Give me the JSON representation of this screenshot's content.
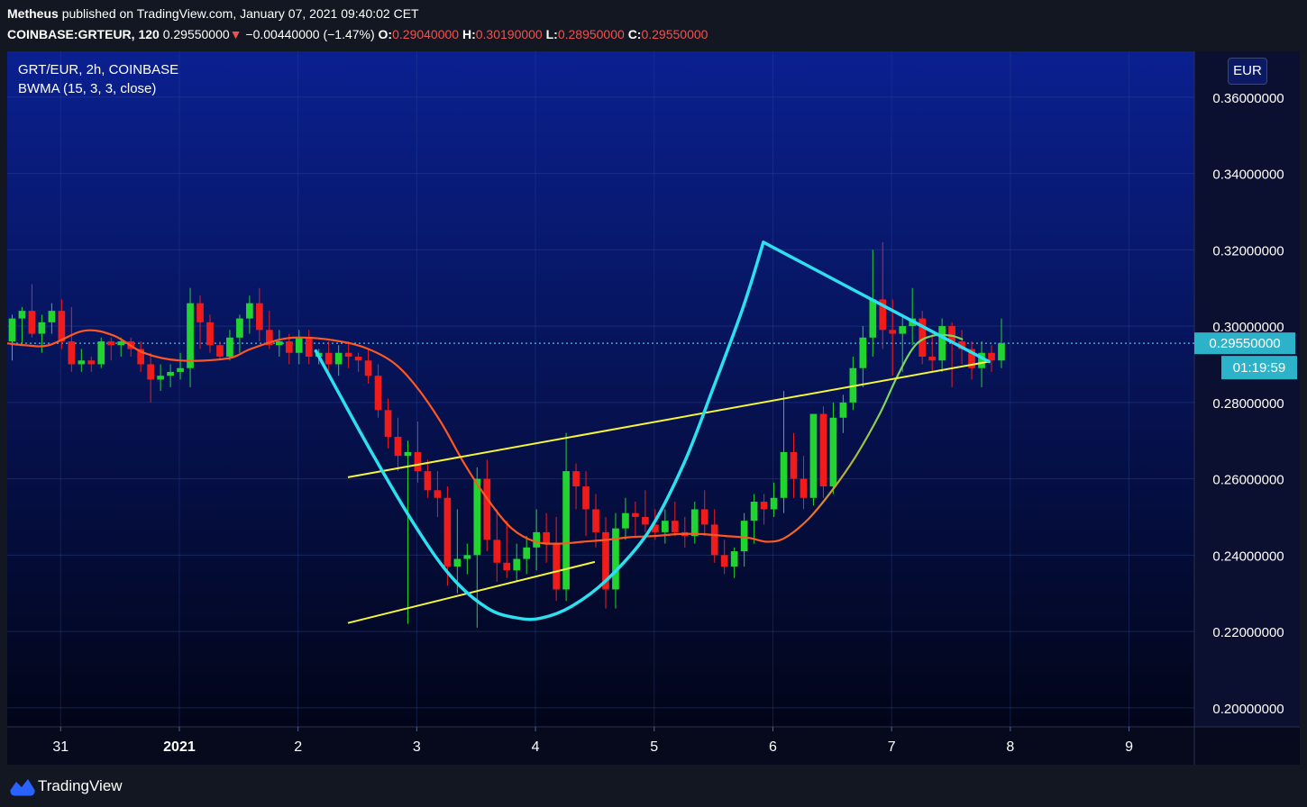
{
  "header": {
    "author": "Metheus",
    "published_text": "published on TradingView.com, January 07, 2021 09:40:02 CET",
    "symbol_text": "COINBASE:GRTEUR, 120",
    "last_price": "0.29550000",
    "change_arrow": "▼",
    "change_text": "−0.00440000 (−1.47%)",
    "open_label": "O:",
    "open_value": "0.29040000",
    "high_label": "H:",
    "high_value": "0.30190000",
    "low_label": "L:",
    "low_value": "0.28950000",
    "close_label": "C:",
    "close_value": "0.29550000"
  },
  "legend": {
    "symbol": "GRT/EUR, 2h, COINBASE",
    "indicator": "BWMA (15, 3, 3, close)"
  },
  "currency_button": "EUR",
  "price_label": "0.29550000",
  "countdown_label": "01:19:59",
  "footer": {
    "brand": "TradingView"
  },
  "colors": {
    "bullish": "#22d430",
    "bearish": "#f01c1c",
    "pattern_cyan": "#2ce0f0",
    "trendline_yellow": "#f5f53a",
    "bwma_orange": "#ff5722",
    "bwma_green": "#7cd85a",
    "background_top": "#0a2090",
    "background_bottom": "#020518"
  },
  "chart_data": {
    "type": "candlestick",
    "symbol": "GRT/EUR",
    "interval": "2h",
    "y_axis": {
      "range": [
        0.195,
        0.372
      ],
      "ticks": [
        "0.36000000",
        "0.34000000",
        "0.32000000",
        "0.30000000",
        "0.28000000",
        "0.26000000",
        "0.24000000",
        "0.22000000",
        "0.20000000"
      ],
      "tick_values": [
        0.36,
        0.34,
        0.32,
        0.3,
        0.28,
        0.26,
        0.24,
        0.22,
        0.2
      ],
      "position": "right"
    },
    "x_axis": {
      "labels": [
        "31",
        "2021",
        "2",
        "3",
        "4",
        "5",
        "6",
        "7",
        "8",
        "9"
      ],
      "label_days": [
        -1,
        0,
        1,
        2,
        3,
        4,
        5,
        6,
        7,
        8
      ],
      "range_days": [
        -1.45,
        8.55
      ]
    },
    "grid": true,
    "last_price_line": 0.2955,
    "candles_day_offset_start": -1.45,
    "candles_step_days": 0.0833333,
    "candles_ohlc": [
      [
        0.296,
        0.303,
        0.291,
        0.302
      ],
      [
        0.302,
        0.305,
        0.295,
        0.304
      ],
      [
        0.304,
        0.311,
        0.297,
        0.298
      ],
      [
        0.298,
        0.303,
        0.293,
        0.301
      ],
      [
        0.301,
        0.306,
        0.298,
        0.304
      ],
      [
        0.304,
        0.307,
        0.294,
        0.296
      ],
      [
        0.296,
        0.305,
        0.288,
        0.29
      ],
      [
        0.29,
        0.294,
        0.288,
        0.291
      ],
      [
        0.291,
        0.292,
        0.288,
        0.29
      ],
      [
        0.29,
        0.297,
        0.289,
        0.296
      ],
      [
        0.296,
        0.297,
        0.291,
        0.295
      ],
      [
        0.295,
        0.297,
        0.292,
        0.296
      ],
      [
        0.296,
        0.297,
        0.292,
        0.294
      ],
      [
        0.294,
        0.296,
        0.288,
        0.29
      ],
      [
        0.29,
        0.293,
        0.28,
        0.286
      ],
      [
        0.286,
        0.29,
        0.283,
        0.287
      ],
      [
        0.287,
        0.29,
        0.284,
        0.288
      ],
      [
        0.288,
        0.293,
        0.286,
        0.289
      ],
      [
        0.289,
        0.31,
        0.284,
        0.306
      ],
      [
        0.306,
        0.308,
        0.294,
        0.301
      ],
      [
        0.301,
        0.303,
        0.293,
        0.295
      ],
      [
        0.295,
        0.296,
        0.291,
        0.292
      ],
      [
        0.292,
        0.299,
        0.291,
        0.297
      ],
      [
        0.297,
        0.303,
        0.293,
        0.302
      ],
      [
        0.302,
        0.308,
        0.298,
        0.306
      ],
      [
        0.306,
        0.31,
        0.296,
        0.299
      ],
      [
        0.299,
        0.304,
        0.294,
        0.295
      ],
      [
        0.295,
        0.299,
        0.292,
        0.296
      ],
      [
        0.296,
        0.298,
        0.29,
        0.293
      ],
      [
        0.293,
        0.299,
        0.29,
        0.297
      ],
      [
        0.297,
        0.299,
        0.29,
        0.292
      ],
      [
        0.292,
        0.294,
        0.29,
        0.293
      ],
      [
        0.293,
        0.296,
        0.288,
        0.29
      ],
      [
        0.29,
        0.295,
        0.287,
        0.293
      ],
      [
        0.293,
        0.296,
        0.289,
        0.292
      ],
      [
        0.292,
        0.293,
        0.288,
        0.291
      ],
      [
        0.291,
        0.294,
        0.285,
        0.287
      ],
      [
        0.287,
        0.29,
        0.276,
        0.278
      ],
      [
        0.278,
        0.281,
        0.268,
        0.271
      ],
      [
        0.271,
        0.276,
        0.262,
        0.266
      ],
      [
        0.266,
        0.27,
        0.222,
        0.267
      ],
      [
        0.267,
        0.275,
        0.259,
        0.262
      ],
      [
        0.262,
        0.265,
        0.255,
        0.257
      ],
      [
        0.257,
        0.262,
        0.25,
        0.255
      ],
      [
        0.255,
        0.258,
        0.232,
        0.237
      ],
      [
        0.237,
        0.252,
        0.23,
        0.239
      ],
      [
        0.239,
        0.243,
        0.235,
        0.24
      ],
      [
        0.24,
        0.263,
        0.221,
        0.26
      ],
      [
        0.26,
        0.265,
        0.241,
        0.244
      ],
      [
        0.244,
        0.252,
        0.233,
        0.238
      ],
      [
        0.238,
        0.249,
        0.234,
        0.236
      ],
      [
        0.236,
        0.243,
        0.233,
        0.239
      ],
      [
        0.239,
        0.245,
        0.235,
        0.242
      ],
      [
        0.242,
        0.252,
        0.236,
        0.246
      ],
      [
        0.246,
        0.251,
        0.238,
        0.243
      ],
      [
        0.243,
        0.25,
        0.228,
        0.231
      ],
      [
        0.231,
        0.272,
        0.228,
        0.262
      ],
      [
        0.262,
        0.264,
        0.252,
        0.258
      ],
      [
        0.258,
        0.262,
        0.245,
        0.252
      ],
      [
        0.252,
        0.256,
        0.242,
        0.246
      ],
      [
        0.246,
        0.25,
        0.226,
        0.231
      ],
      [
        0.231,
        0.251,
        0.226,
        0.247
      ],
      [
        0.247,
        0.255,
        0.244,
        0.251
      ],
      [
        0.251,
        0.254,
        0.245,
        0.25
      ],
      [
        0.25,
        0.257,
        0.246,
        0.248
      ],
      [
        0.248,
        0.252,
        0.244,
        0.246
      ],
      [
        0.246,
        0.252,
        0.243,
        0.249
      ],
      [
        0.249,
        0.254,
        0.245,
        0.246
      ],
      [
        0.246,
        0.25,
        0.242,
        0.245
      ],
      [
        0.245,
        0.254,
        0.243,
        0.252
      ],
      [
        0.252,
        0.257,
        0.245,
        0.248
      ],
      [
        0.248,
        0.252,
        0.238,
        0.24
      ],
      [
        0.24,
        0.244,
        0.235,
        0.237
      ],
      [
        0.237,
        0.242,
        0.234,
        0.241
      ],
      [
        0.241,
        0.251,
        0.237,
        0.249
      ],
      [
        0.249,
        0.256,
        0.243,
        0.254
      ],
      [
        0.254,
        0.256,
        0.248,
        0.252
      ],
      [
        0.252,
        0.259,
        0.25,
        0.255
      ],
      [
        0.255,
        0.283,
        0.251,
        0.267
      ],
      [
        0.267,
        0.272,
        0.255,
        0.26
      ],
      [
        0.26,
        0.266,
        0.252,
        0.255
      ],
      [
        0.255,
        0.273,
        0.253,
        0.277
      ],
      [
        0.277,
        0.279,
        0.255,
        0.258
      ],
      [
        0.258,
        0.28,
        0.256,
        0.276
      ],
      [
        0.276,
        0.282,
        0.272,
        0.28
      ],
      [
        0.28,
        0.292,
        0.278,
        0.289
      ],
      [
        0.289,
        0.3,
        0.284,
        0.297
      ],
      [
        0.297,
        0.32,
        0.292,
        0.307
      ],
      [
        0.307,
        0.322,
        0.294,
        0.299
      ],
      [
        0.299,
        0.307,
        0.287,
        0.298
      ],
      [
        0.298,
        0.303,
        0.288,
        0.3
      ],
      [
        0.3,
        0.31,
        0.295,
        0.302
      ],
      [
        0.302,
        0.304,
        0.29,
        0.292
      ],
      [
        0.292,
        0.298,
        0.288,
        0.291
      ],
      [
        0.291,
        0.302,
        0.288,
        0.3
      ],
      [
        0.3,
        0.301,
        0.284,
        0.296
      ],
      [
        0.296,
        0.299,
        0.29,
        0.294
      ],
      [
        0.294,
        0.296,
        0.286,
        0.289
      ],
      [
        0.289,
        0.296,
        0.284,
        0.293
      ],
      [
        0.293,
        0.295,
        0.288,
        0.291
      ],
      [
        0.291,
        0.302,
        0.289,
        0.2955
      ]
    ],
    "bwma_series": {
      "name": "BWMA (15, 3, 3, close)",
      "points": [
        [
          -1.45,
          0.2955
        ],
        [
          -1.3,
          0.295
        ],
        [
          -1.1,
          0.295
        ],
        [
          -0.8,
          0.2988
        ],
        [
          -0.55,
          0.2975
        ],
        [
          -0.3,
          0.293
        ],
        [
          0.0,
          0.291
        ],
        [
          0.4,
          0.2915
        ],
        [
          0.6,
          0.294
        ],
        [
          0.85,
          0.2965
        ],
        [
          1.05,
          0.297
        ],
        [
          1.3,
          0.2963
        ],
        [
          1.55,
          0.2945
        ],
        [
          1.8,
          0.2905
        ],
        [
          2.0,
          0.284
        ],
        [
          2.2,
          0.275
        ],
        [
          2.4,
          0.264
        ],
        [
          2.6,
          0.2545
        ],
        [
          2.8,
          0.247
        ],
        [
          3.0,
          0.2435
        ],
        [
          3.2,
          0.243
        ],
        [
          3.4,
          0.2435
        ],
        [
          3.6,
          0.244
        ],
        [
          3.8,
          0.2447
        ],
        [
          4.0,
          0.245
        ],
        [
          4.2,
          0.2455
        ],
        [
          4.4,
          0.2455
        ],
        [
          4.6,
          0.245
        ],
        [
          4.8,
          0.2445
        ],
        [
          4.95,
          0.2435
        ],
        [
          5.1,
          0.2445
        ],
        [
          5.3,
          0.2495
        ],
        [
          5.5,
          0.257
        ],
        [
          5.7,
          0.266
        ],
        [
          5.9,
          0.277
        ],
        [
          6.05,
          0.287
        ],
        [
          6.2,
          0.295
        ],
        [
          6.35,
          0.2975
        ],
        [
          6.5,
          0.2975
        ],
        [
          6.6,
          0.2965
        ]
      ]
    },
    "patterns": {
      "cup_curve": [
        [
          1.15,
          0.2935
        ],
        [
          1.6,
          0.268
        ],
        [
          2.0,
          0.247
        ],
        [
          2.3,
          0.234
        ],
        [
          2.6,
          0.226
        ],
        [
          2.85,
          0.2235
        ],
        [
          3.05,
          0.2235
        ],
        [
          3.3,
          0.2265
        ],
        [
          3.6,
          0.2335
        ],
        [
          3.95,
          0.246
        ],
        [
          4.25,
          0.264
        ],
        [
          4.5,
          0.284
        ],
        [
          4.75,
          0.305
        ],
        [
          4.92,
          0.322
        ]
      ],
      "triangle_upper": [
        [
          4.92,
          0.322
        ],
        [
          6.82,
          0.2907
        ]
      ],
      "channel_upper": [
        [
          1.42,
          0.2604
        ],
        [
          6.82,
          0.2907
        ]
      ],
      "channel_lower": [
        [
          1.42,
          0.2222
        ],
        [
          3.5,
          0.2382
        ]
      ]
    }
  }
}
